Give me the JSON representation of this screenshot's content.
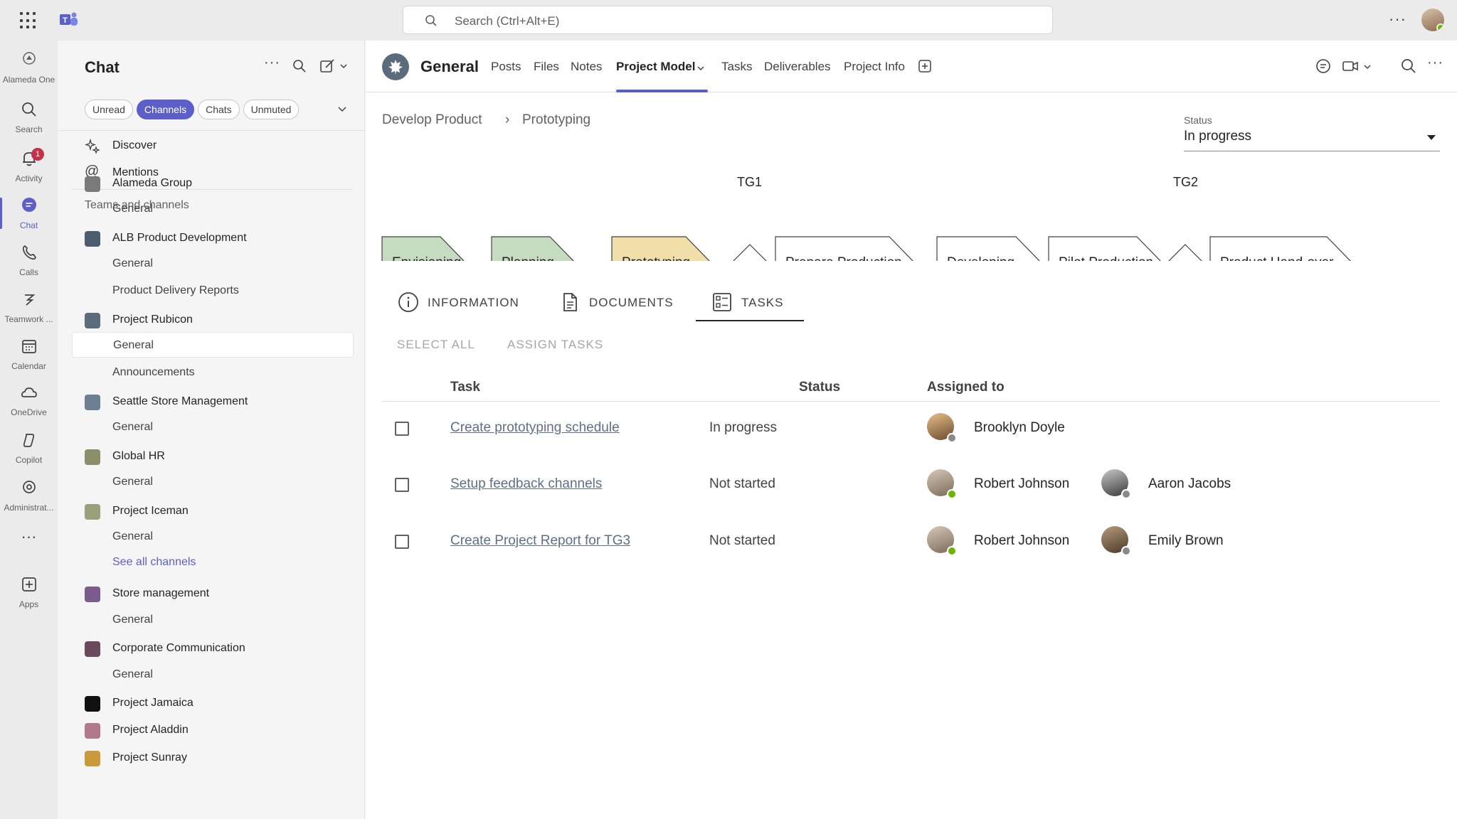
{
  "topbar": {
    "search_placeholder": "Search (Ctrl+Alt+E)",
    "more_label": "···"
  },
  "rail": {
    "items": [
      {
        "label": "Alameda One",
        "icon": "org-logo-icon"
      },
      {
        "label": "Search",
        "icon": "search-icon"
      },
      {
        "label": "Activity",
        "icon": "bell-icon",
        "badge": "1"
      },
      {
        "label": "Chat",
        "icon": "chat-icon",
        "active": true
      },
      {
        "label": "Calls",
        "icon": "phone-icon"
      },
      {
        "label": "Teamwork ...",
        "icon": "teamwork-icon"
      },
      {
        "label": "Calendar",
        "icon": "calendar-icon"
      },
      {
        "label": "OneDrive",
        "icon": "cloud-icon"
      },
      {
        "label": "Copilot",
        "icon": "copilot-icon"
      },
      {
        "label": "Administrat...",
        "icon": "admin-icon"
      },
      {
        "label": "···",
        "icon": "more-icon"
      },
      {
        "label": "Apps",
        "icon": "add-apps-icon"
      }
    ]
  },
  "chat": {
    "title": "Chat",
    "filters": [
      "Unread",
      "Channels",
      "Chats",
      "Unmuted"
    ],
    "active_filter": "Channels",
    "discover": "Discover",
    "mentions": "Mentions",
    "section_title": "Teams and channels",
    "rows": [
      {
        "label": "Alameda Group",
        "type": "team",
        "icon_color": "#7a7a7a"
      },
      {
        "label": "General",
        "type": "channel"
      },
      {
        "label": "ALB Product Development",
        "type": "team",
        "icon_color": "#4b5d6e"
      },
      {
        "label": "General",
        "type": "channel"
      },
      {
        "label": "Product Delivery Reports",
        "type": "channel"
      },
      {
        "label": "Project Rubicon",
        "type": "team",
        "icon_color": "#5a6b7b"
      },
      {
        "label": "General",
        "type": "channel",
        "selected": true
      },
      {
        "label": "Announcements",
        "type": "channel"
      },
      {
        "label": "Seattle Store Management",
        "type": "team",
        "icon_color": "#6d7f91"
      },
      {
        "label": "General",
        "type": "channel"
      },
      {
        "label": "Global HR",
        "type": "team",
        "icon_color": "#8a8f6a"
      },
      {
        "label": "General",
        "type": "channel"
      },
      {
        "label": "Project Iceman",
        "type": "team",
        "icon_color": "#9aa07a"
      },
      {
        "label": "General",
        "type": "channel"
      },
      {
        "label": "See all channels",
        "type": "link"
      },
      {
        "label": "Store management",
        "type": "team",
        "icon_color": "#7b5b8a"
      },
      {
        "label": "General",
        "type": "channel"
      },
      {
        "label": "Corporate Communication",
        "type": "team",
        "icon_color": "#6b4a5e"
      },
      {
        "label": "General",
        "type": "channel"
      },
      {
        "label": "Project Jamaica",
        "type": "team",
        "icon_color": "#111111"
      },
      {
        "label": "Project Aladdin",
        "type": "team",
        "icon_color": "#b07a8a"
      },
      {
        "label": "Project Sunray",
        "type": "team",
        "icon_color": "#c99a3a"
      }
    ]
  },
  "channel": {
    "name": "General",
    "tabs": [
      "Posts",
      "Files",
      "Notes",
      "Project Model",
      "Tasks",
      "Deliverables",
      "Project Info"
    ],
    "active_tab": "Project Model"
  },
  "breadcrumb": {
    "parent": "Develop Product",
    "separator": "›",
    "current": "Prototyping"
  },
  "status": {
    "label": "Status",
    "value": "In progress"
  },
  "phases": {
    "steps": [
      {
        "label": "Envisioning",
        "state": "done",
        "color": "#c5dcc0"
      },
      {
        "label": "Planning",
        "state": "done",
        "color": "#c5dcc0"
      },
      {
        "label": "Prototyping",
        "state": "current",
        "color": "#f0dfa8"
      },
      {
        "label": "Prepare Production",
        "state": "todo",
        "color": "#ffffff"
      },
      {
        "label": "Developing",
        "state": "todo",
        "color": "#ffffff"
      },
      {
        "label": "Pilot Production",
        "state": "todo",
        "color": "#ffffff"
      },
      {
        "label": "Product Hand-over",
        "state": "todo",
        "color": "#ffffff"
      }
    ],
    "gates": [
      "TG1",
      "TG2"
    ]
  },
  "detail_tabs": {
    "items": [
      "INFORMATION",
      "DOCUMENTS",
      "TASKS"
    ],
    "active": "TASKS"
  },
  "actions": {
    "select_all": "SELECT ALL",
    "assign_tasks": "ASSIGN TASKS"
  },
  "table": {
    "headers": {
      "task": "Task",
      "status": "Status",
      "assigned": "Assigned to"
    },
    "rows": [
      {
        "task": "Create prototyping schedule",
        "status": "In progress",
        "assignees": [
          {
            "name": "Brooklyn Doyle",
            "presence": "away"
          }
        ]
      },
      {
        "task": "Setup feedback channels",
        "status": "Not started",
        "assignees": [
          {
            "name": "Robert Johnson",
            "presence": "available"
          },
          {
            "name": "Aaron Jacobs",
            "presence": "away"
          }
        ]
      },
      {
        "task": "Create Project Report for TG3",
        "status": "Not started",
        "assignees": [
          {
            "name": "Robert Johnson",
            "presence": "available"
          },
          {
            "name": "Emily Brown",
            "presence": "away"
          }
        ]
      }
    ]
  },
  "colors": {
    "accent": "#5b5fc7",
    "done_phase": "#c5dcc0",
    "current_phase": "#f0dfa8"
  }
}
